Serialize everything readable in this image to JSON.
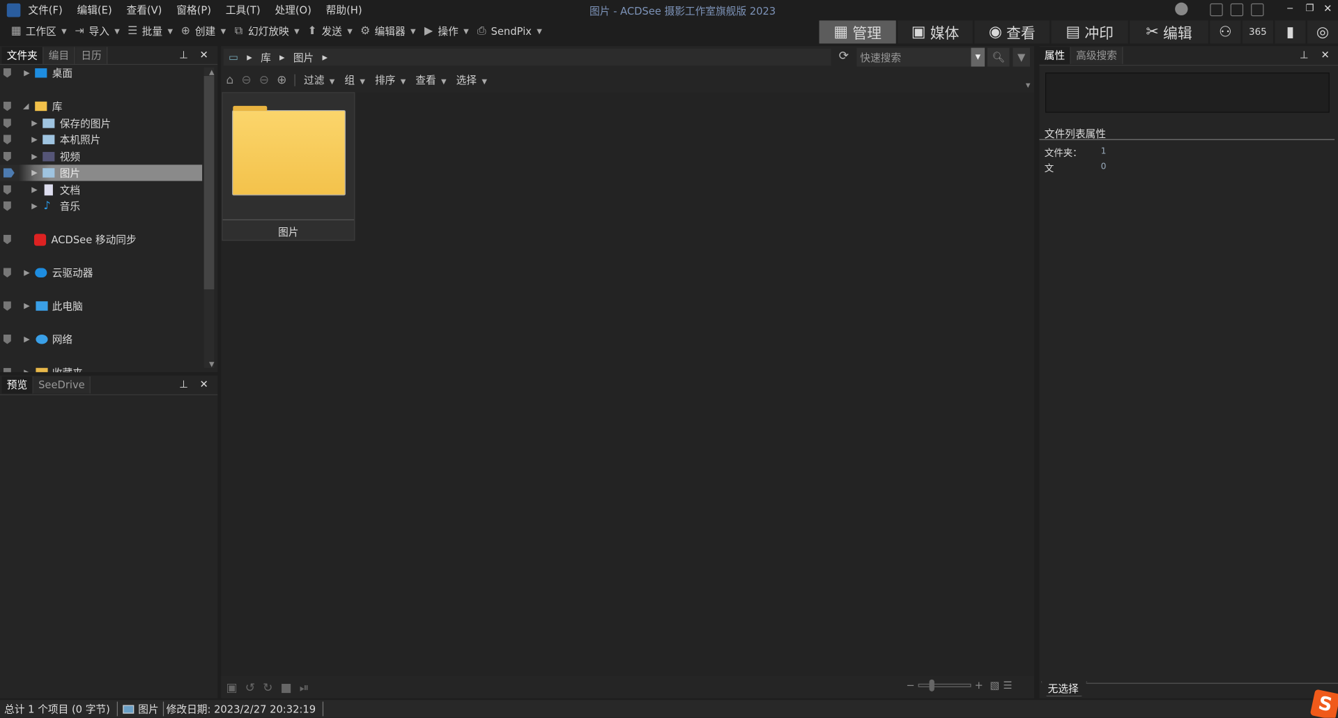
{
  "title": "图片 - ACDSee 摄影工作室旗舰版 2023",
  "menu": [
    "文件(F)",
    "编辑(E)",
    "查看(V)",
    "窗格(P)",
    "工具(T)",
    "处理(O)",
    "帮助(H)"
  ],
  "toolbar": [
    {
      "label": "工作区",
      "icon": "workspace-icon"
    },
    {
      "label": "导入",
      "icon": "import-icon"
    },
    {
      "label": "批量",
      "icon": "batch-icon"
    },
    {
      "label": "创建",
      "icon": "create-icon"
    },
    {
      "label": "幻灯放映",
      "icon": "slideshow-icon"
    },
    {
      "label": "发送",
      "icon": "send-icon"
    },
    {
      "label": "编辑器",
      "icon": "editor-icon"
    },
    {
      "label": "操作",
      "icon": "actions-icon"
    },
    {
      "label": "SendPix",
      "icon": "sendpix-icon"
    }
  ],
  "modes": [
    {
      "label": "管理",
      "icon": "grid-icon",
      "active": true
    },
    {
      "label": "媒体",
      "icon": "media-icon"
    },
    {
      "label": "查看",
      "icon": "eye-icon"
    },
    {
      "label": "冲印",
      "icon": "develop-icon"
    },
    {
      "label": "编辑",
      "icon": "edit-icon"
    }
  ],
  "left_tabs": [
    "文件夹",
    "编目",
    "日历"
  ],
  "tree": [
    {
      "label": "桌面"
    },
    {
      "label": "库"
    },
    {
      "label": "保存的图片"
    },
    {
      "label": "本机照片"
    },
    {
      "label": "视频"
    },
    {
      "label": "图片",
      "selected": true
    },
    {
      "label": "文档"
    },
    {
      "label": "音乐"
    },
    {
      "label": "ACDSee 移动同步"
    },
    {
      "label": "云驱动器"
    },
    {
      "label": "此电脑"
    },
    {
      "label": "网络"
    },
    {
      "label": "收藏夹"
    }
  ],
  "preview_tabs": [
    "预览",
    "SeeDrive"
  ],
  "breadcrumb": [
    "库",
    "图片"
  ],
  "quick_search_placeholder": "快速搜索",
  "browser_toolbar": [
    "过滤",
    "组",
    "排序",
    "查看",
    "选择"
  ],
  "items": [
    {
      "name": "图片",
      "type": "folder"
    }
  ],
  "right_tabs": [
    "属性",
    "高级搜索"
  ],
  "properties": {
    "heading": "文件列表属性",
    "rows": [
      {
        "label": "文件夹：",
        "value": "1"
      },
      {
        "label": "文",
        "value": "0"
      }
    ]
  },
  "no_selection": "无选择",
  "status": {
    "total": "总计 1 个项目  (0 字节)",
    "item": "图片",
    "modified": "修改日期: 2023/2/27 20:32:19"
  },
  "colors": {
    "accent_active": "#5c5c5c",
    "selection": "#8a8a8a",
    "folder": "#f5c84c"
  }
}
